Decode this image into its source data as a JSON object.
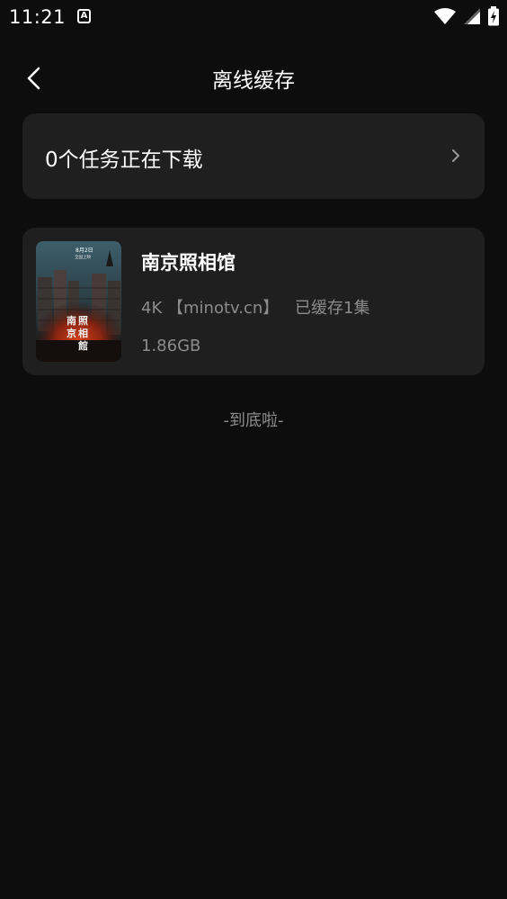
{
  "status_bar": {
    "time": "11:21",
    "notification_badge": "A",
    "icons": [
      "wifi-icon",
      "cell-signal-icon",
      "battery-charging-icon"
    ]
  },
  "header": {
    "title": "离线缓存",
    "back_icon": "chevron-left-icon"
  },
  "download_task": {
    "label": "0个任务正在下载",
    "icon": "chevron-right-icon"
  },
  "cached_items": [
    {
      "title": "南京照相馆",
      "quality": "4K",
      "source": "【minotv.cn】",
      "episodes": "已缓存1集",
      "size": "1.86GB",
      "poster": {
        "date_text": "8月2日",
        "sub_text": "全国上映",
        "title_chars": [
          "南",
          "照",
          "京",
          "相",
          "館"
        ]
      }
    }
  ],
  "footer": {
    "end_text": "-到底啦-"
  },
  "colors": {
    "background": "#0d0d0d",
    "card": "#1f1f1f",
    "primary_text": "#ffffff",
    "secondary_text": "#8c8c8c"
  }
}
